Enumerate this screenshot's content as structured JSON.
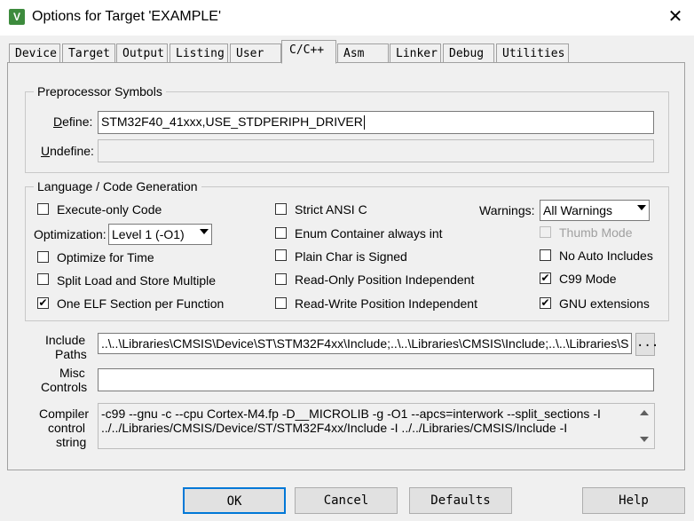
{
  "window": {
    "title": "Options for Target 'EXAMPLE'",
    "close": "✕"
  },
  "tabs": [
    {
      "label": "Device"
    },
    {
      "label": "Target"
    },
    {
      "label": "Output"
    },
    {
      "label": "Listing"
    },
    {
      "label": "User"
    },
    {
      "label": "C/C++"
    },
    {
      "label": "Asm"
    },
    {
      "label": "Linker"
    },
    {
      "label": "Debug"
    },
    {
      "label": "Utilities"
    }
  ],
  "preprocessor": {
    "group_title": "Preprocessor Symbols",
    "define_label": "Define:",
    "define_value": "STM32F40_41xxx,USE_STDPERIPH_DRIVER",
    "undefine_label": "Undefine:",
    "undefine_value": ""
  },
  "codegen": {
    "group_title": "Language / Code Generation",
    "execute_only": {
      "label": "Execute-only Code",
      "checked": false
    },
    "optimization_label": "Optimization:",
    "optimization_value": "Level 1 (-O1)",
    "optimize_time": {
      "label": "Optimize for Time",
      "checked": false
    },
    "split_load": {
      "label": "Split Load and Store Multiple",
      "checked": false
    },
    "one_elf": {
      "label": "One ELF Section per Function",
      "checked": true
    },
    "strict_ansi": {
      "label": "Strict ANSI C",
      "checked": false
    },
    "enum_container": {
      "label": "Enum Container always int",
      "checked": false
    },
    "plain_char": {
      "label": "Plain Char is Signed",
      "checked": false
    },
    "ro_pi": {
      "label": "Read-Only Position Independent",
      "checked": false
    },
    "rw_pi": {
      "label": "Read-Write Position Independent",
      "checked": false
    },
    "warnings_label": "Warnings:",
    "warnings_value": "All Warnings",
    "thumb_mode": {
      "label": "Thumb Mode",
      "checked": false,
      "disabled": true
    },
    "no_auto_includes": {
      "label": "No Auto Includes",
      "checked": false
    },
    "c99_mode": {
      "label": "C99 Mode",
      "checked": true
    },
    "gnu_ext": {
      "label": "GNU extensions",
      "checked": true
    }
  },
  "paths": {
    "include_label_1": "Include",
    "include_label_2": "Paths",
    "include_value": "..\\..\\Libraries\\CMSIS\\Device\\ST\\STM32F4xx\\Include;..\\..\\Libraries\\CMSIS\\Include;..\\..\\Libraries\\S",
    "browse": "...",
    "misc_label_1": "Misc",
    "misc_label_2": "Controls",
    "misc_value": "",
    "compiler_label_1": "Compiler",
    "compiler_label_2": "control",
    "compiler_label_3": "string",
    "compiler_line_1": "-c99 --gnu -c --cpu Cortex-M4.fp -D__MICROLIB -g -O1 --apcs=interwork --split_sections -I",
    "compiler_line_2": "../../Libraries/CMSIS/Device/ST/STM32F4xx/Include -I ../../Libraries/CMSIS/Include -I"
  },
  "buttons": {
    "ok": "OK",
    "cancel": "Cancel",
    "defaults": "Defaults",
    "help": "Help"
  },
  "check_mark": "✔"
}
